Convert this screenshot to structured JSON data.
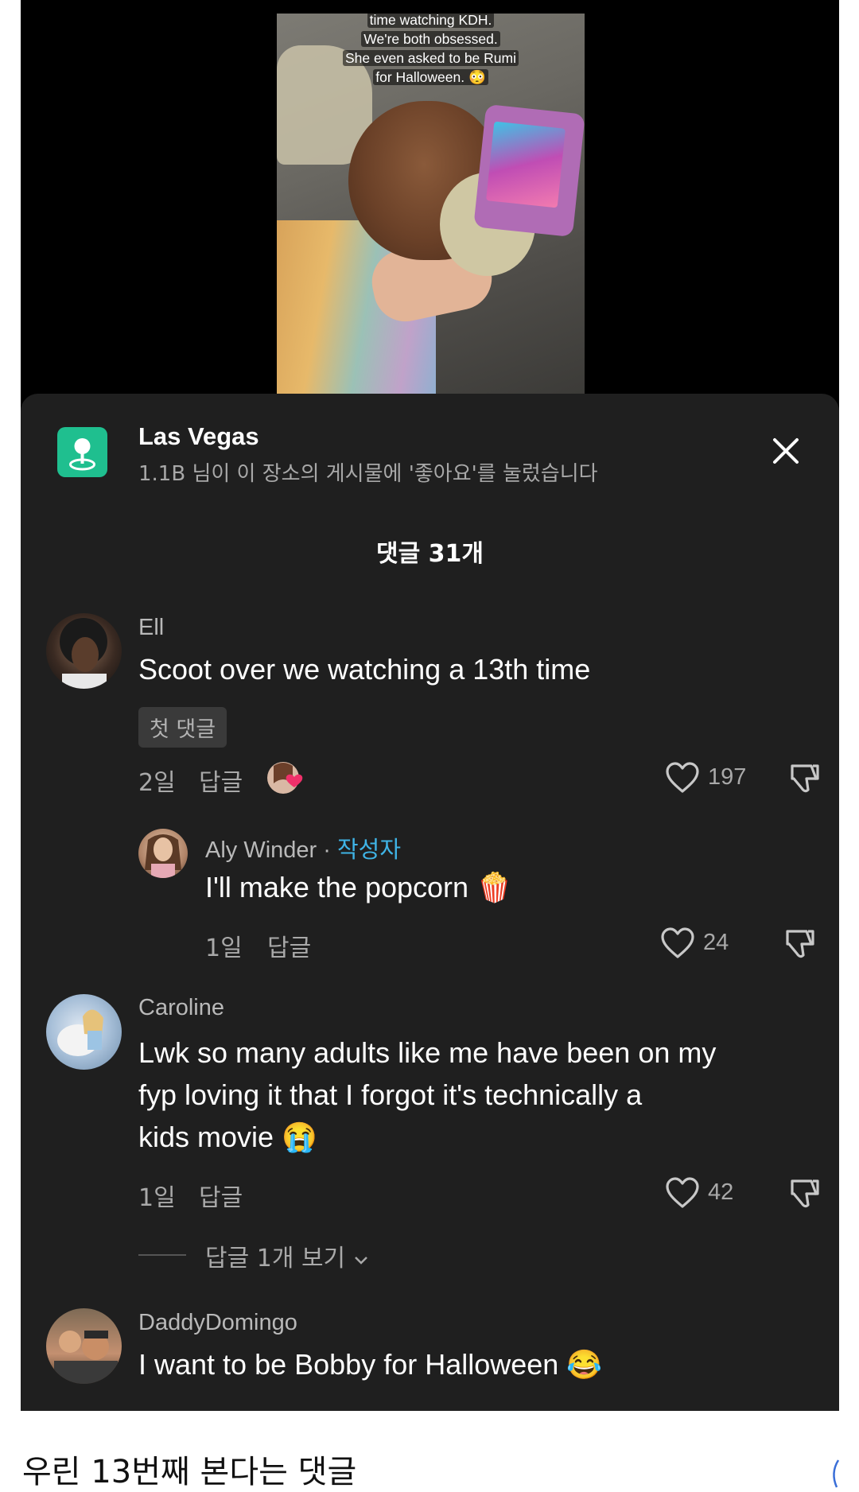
{
  "video": {
    "caption_lines": [
      "time watching KDH.",
      "We're both obsessed.",
      "She even asked to be Rumi",
      "for Halloween. 😳"
    ]
  },
  "location": {
    "name": "Las Vegas",
    "subtitle": "1.1B 님이 이 장소의 게시물에 '좋아요'를 눌렀습니다"
  },
  "comments_header": "댓글 31개",
  "comments": [
    {
      "user": "Ell",
      "text": "Scoot over we watching a 13th time",
      "badge": "첫 댓글",
      "age": "2일",
      "reply": "답글",
      "likes": "197"
    },
    {
      "user": "Aly Winder",
      "author_tag": "작성자",
      "text": "I'll make the popcorn 🍿",
      "age": "1일",
      "reply": "답글",
      "likes": "24"
    },
    {
      "user": "Caroline",
      "text_lines": [
        "Lwk so many adults like me have been on my",
        "fyp loving it that I forgot it's technically a",
        "kids movie 😭"
      ],
      "age": "1일",
      "reply": "답글",
      "likes": "42",
      "view_replies": "답글 1개 보기"
    },
    {
      "user": "DaddyDomingo",
      "text": "I want to be Bobby for Halloween 😂"
    }
  ],
  "footer_caption": "우린 13번째 본다는 댓글",
  "colors": {
    "sheet_bg": "#1f1f1f",
    "location_icon": "#1fbf8f",
    "author_tag": "#3fb4e6",
    "badge_bg": "#3a3a3a"
  }
}
